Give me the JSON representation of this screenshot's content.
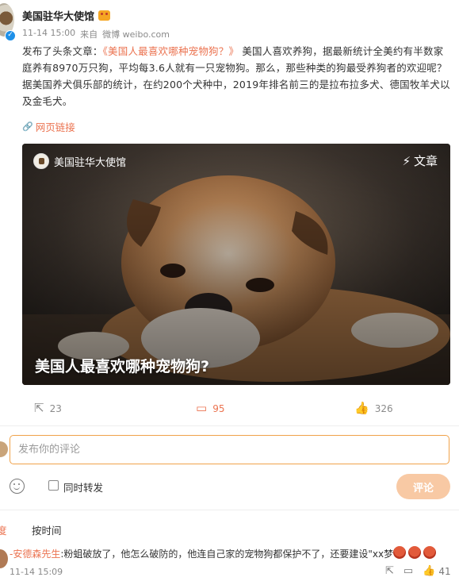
{
  "post": {
    "author": "美国驻华大使馆",
    "time": "11-14 15:00",
    "source_prefix": "来自",
    "source": "微博 weibo.com",
    "content_prefix": "发布了头条文章：",
    "article_link": "《美国人最喜欢哪种宠物狗？》",
    "content_body": " 美国人喜欢养狗，据最新统计全美约有半数家庭养有8970万只狗，平均每3.6人就有一只宠物狗。那么，那些种类的狗最受养狗者的欢迎呢？据美国养犬俱乐部的统计，在约200个犬种中，2019年排名前三的是拉布拉多犬、德国牧羊犬以及金毛犬。",
    "web_link_label": "网页链接"
  },
  "card": {
    "account": "美国驻华大使馆",
    "tag": "文章",
    "title": "美国人最喜欢哪种宠物狗?"
  },
  "actions": {
    "share_count": "23",
    "comment_count": "95",
    "like_count": "326"
  },
  "comment_form": {
    "placeholder": "发布你的评论",
    "repost_label": "同时转发",
    "submit_label": "评论"
  },
  "sort": {
    "hot": "度",
    "time": "按时间"
  },
  "comments": [
    {
      "user": "-安德森先生",
      "text": ":粉蛆破放了，他怎么破防的，他连自己家的宠物狗都保护不了，还要建设\"xx梦\"",
      "time": "11-14 15:09",
      "likes": "41"
    }
  ],
  "icons": {
    "verified": "verified-icon",
    "share": "share-icon",
    "comment": "comment-icon",
    "like": "thumbs-up-icon",
    "article": "lightning-icon",
    "emoji": "emoji-icon"
  },
  "colors": {
    "accent": "#eb7350",
    "input_border": "#f0a24a",
    "submit_bg": "#f8c9a4",
    "verified": "#1e90e8"
  }
}
